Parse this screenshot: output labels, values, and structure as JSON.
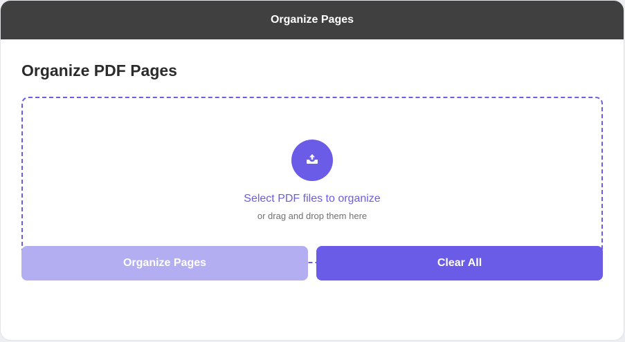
{
  "header": {
    "title": "Organize Pages"
  },
  "main": {
    "title": "Organize PDF Pages",
    "dropzone": {
      "icon": "upload-icon",
      "primary_text": "Select PDF files to organize",
      "secondary_text": "or drag and drop them here"
    },
    "buttons": {
      "organize_label": "Organize Pages",
      "organize_disabled": true,
      "clear_label": "Clear All"
    }
  },
  "colors": {
    "accent": "#6b5ce7",
    "accent_disabled": "#b3adf2",
    "header_bg": "#404040",
    "title_text": "#2b2b2b"
  }
}
